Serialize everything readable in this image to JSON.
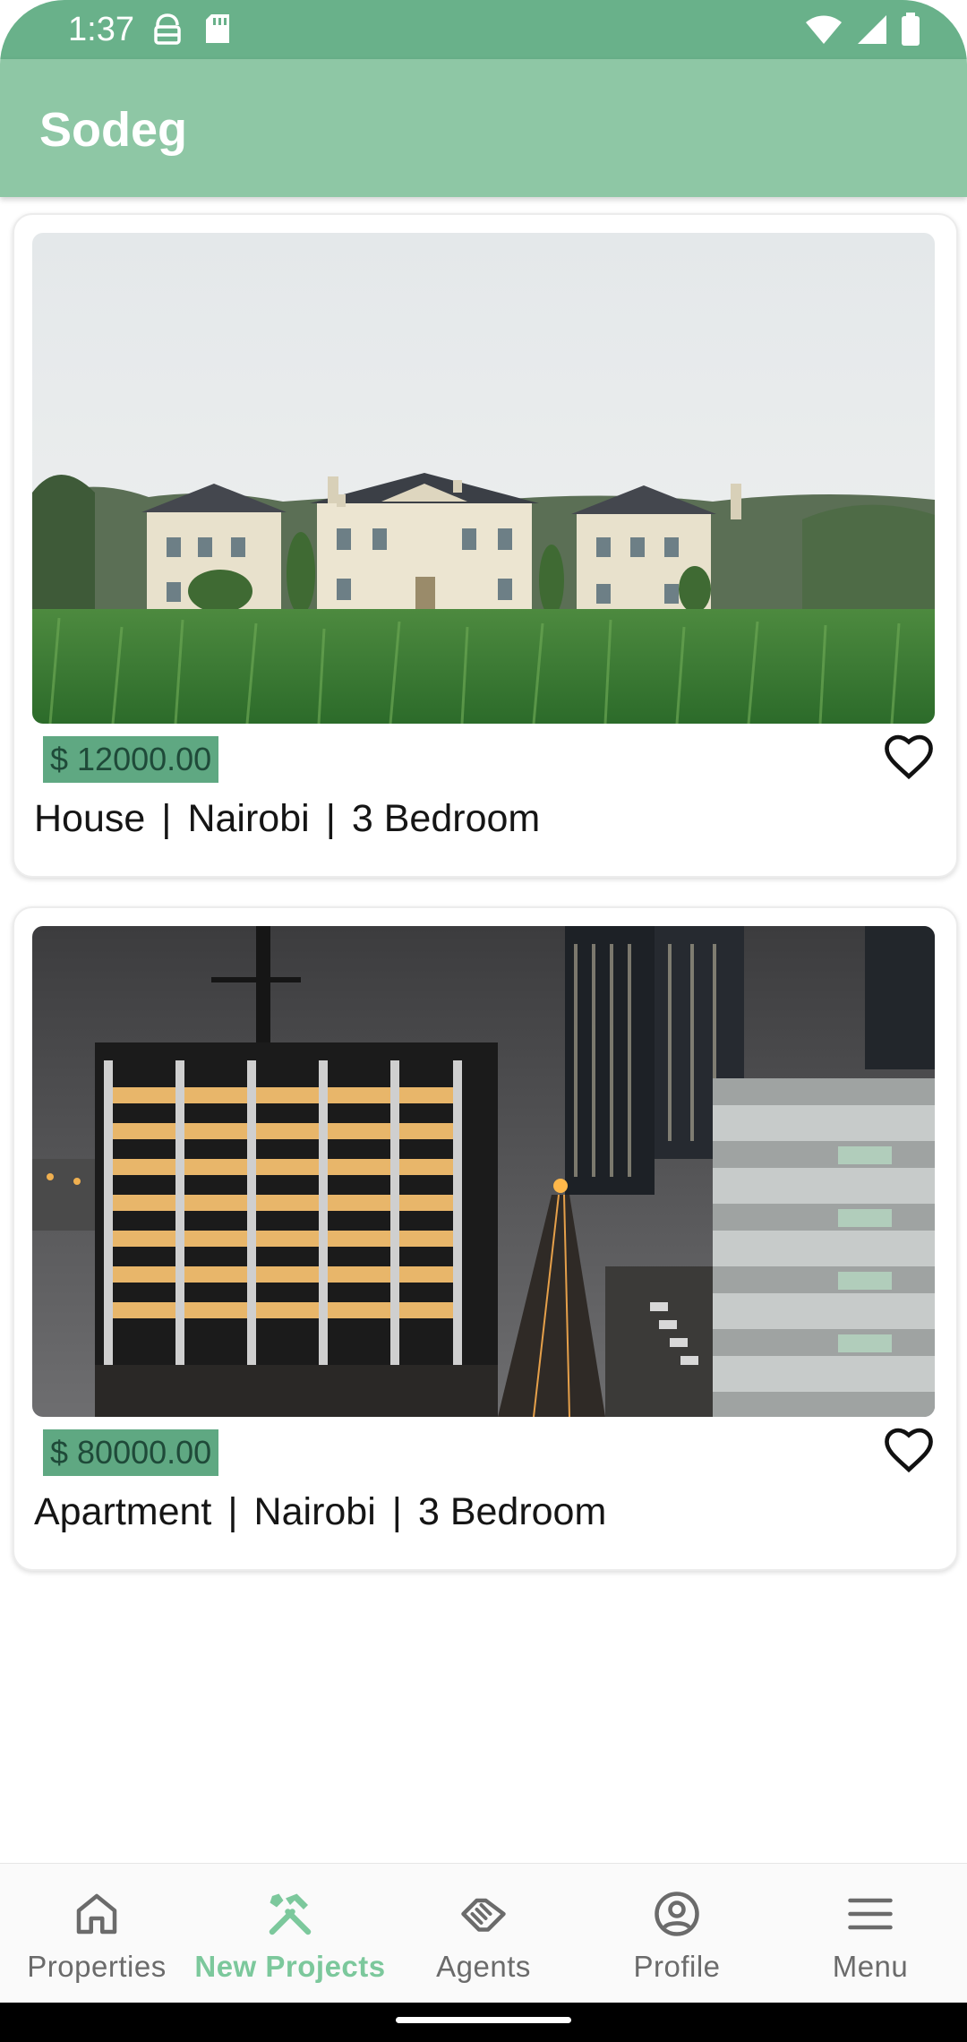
{
  "status_bar": {
    "time": "1:37",
    "icons": [
      "vpn-icon",
      "sd-card-icon",
      "wifi-icon",
      "signal-icon",
      "battery-icon"
    ]
  },
  "app_bar": {
    "title": "Sodeg"
  },
  "listings": [
    {
      "price": "$ 12000.00",
      "type": "House",
      "location": "Nairobi",
      "bedrooms": "3 Bedroom",
      "separator": "|",
      "image": "house-photo"
    },
    {
      "price": "$ 80000.00",
      "type": "Apartment",
      "location": "Nairobi",
      "bedrooms": "3 Bedroom",
      "separator": "|",
      "image": "apartment-photo"
    }
  ],
  "bottom_nav": {
    "items": [
      {
        "label": "Properties",
        "icon": "home-icon",
        "active": false
      },
      {
        "label": "New Projects",
        "icon": "tools-icon",
        "active": true
      },
      {
        "label": "Agents",
        "icon": "handshake-icon",
        "active": false
      },
      {
        "label": "Profile",
        "icon": "account-circle-icon",
        "active": false
      },
      {
        "label": "Menu",
        "icon": "menu-icon",
        "active": false
      }
    ]
  },
  "colors": {
    "status_bar": "#69b18a",
    "app_bar": "#8ec7a5",
    "price_tag": "#5fa882",
    "active_nav": "#7cc89c",
    "inactive_nav": "#6b6b6b"
  }
}
